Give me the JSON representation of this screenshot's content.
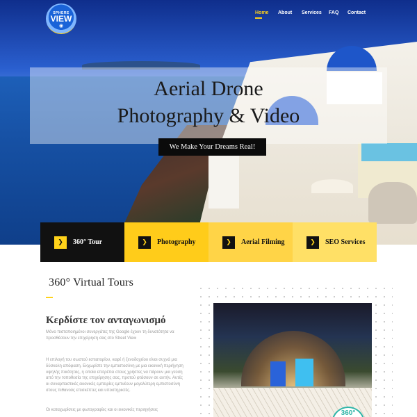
{
  "logo": {
    "top": "SPHERE",
    "main": "VIEW"
  },
  "nav": {
    "items": [
      {
        "label": "Home",
        "active": true
      },
      {
        "label": "About",
        "active": false
      },
      {
        "label": "Services",
        "active": false
      },
      {
        "label": "FAQ",
        "active": false
      },
      {
        "label": "Contact",
        "active": false
      }
    ]
  },
  "hero": {
    "title_line1": "Aerial Drone",
    "title_line2": "Photography & Video",
    "cta": "We Make Your Dreams Real!"
  },
  "services": [
    {
      "label": "360° Tour",
      "icon": "chevron-right-icon"
    },
    {
      "label": "Photography",
      "icon": "chevron-right-icon"
    },
    {
      "label": "Aerial Filming",
      "icon": "chevron-right-icon"
    },
    {
      "label": "SEO Services",
      "icon": "chevron-right-icon"
    }
  ],
  "section": {
    "title": "360° Virtual Tours",
    "subheading": "Κερδίστε τον ανταγωνισμό",
    "paragraph1": "Μόνο πιστοποιημένοι συνεργάτες της Google        έχουν τη δυνατότητα να προσθέσουν την        επιχείρηση σας στο Street View",
    "paragraph2": "Η επιλογή του σωστού εστιατορίου, καφέ ή ξενοδοχείου είναι συχνά μια δύσκολη απόφαση. Εκχωρίστε την εμπιστοσύνη με μια εικονική περιήγηση υψηλής ποιότητας, η οποία επιτρέπει στους χρήστες να πάρουν μια γεύση από την τοποθεσία της επιχείρησης σας, προτού φτάσουν σε αυτήν. Αυτές οι συναρπαστικές εικονικές εμπειρίες εμπνέουν μεγαλύτερη εμπιστοσύνη στους πιθανούς επισκέπτες και υποστηρικτές.",
    "paragraph3": "Οι καταχωρίσεις με φωτογραφίες και οι εικονικές περιηγήσεις",
    "badge": "360°"
  },
  "colors": {
    "accent": "#ffd21a",
    "dark": "#111111"
  }
}
